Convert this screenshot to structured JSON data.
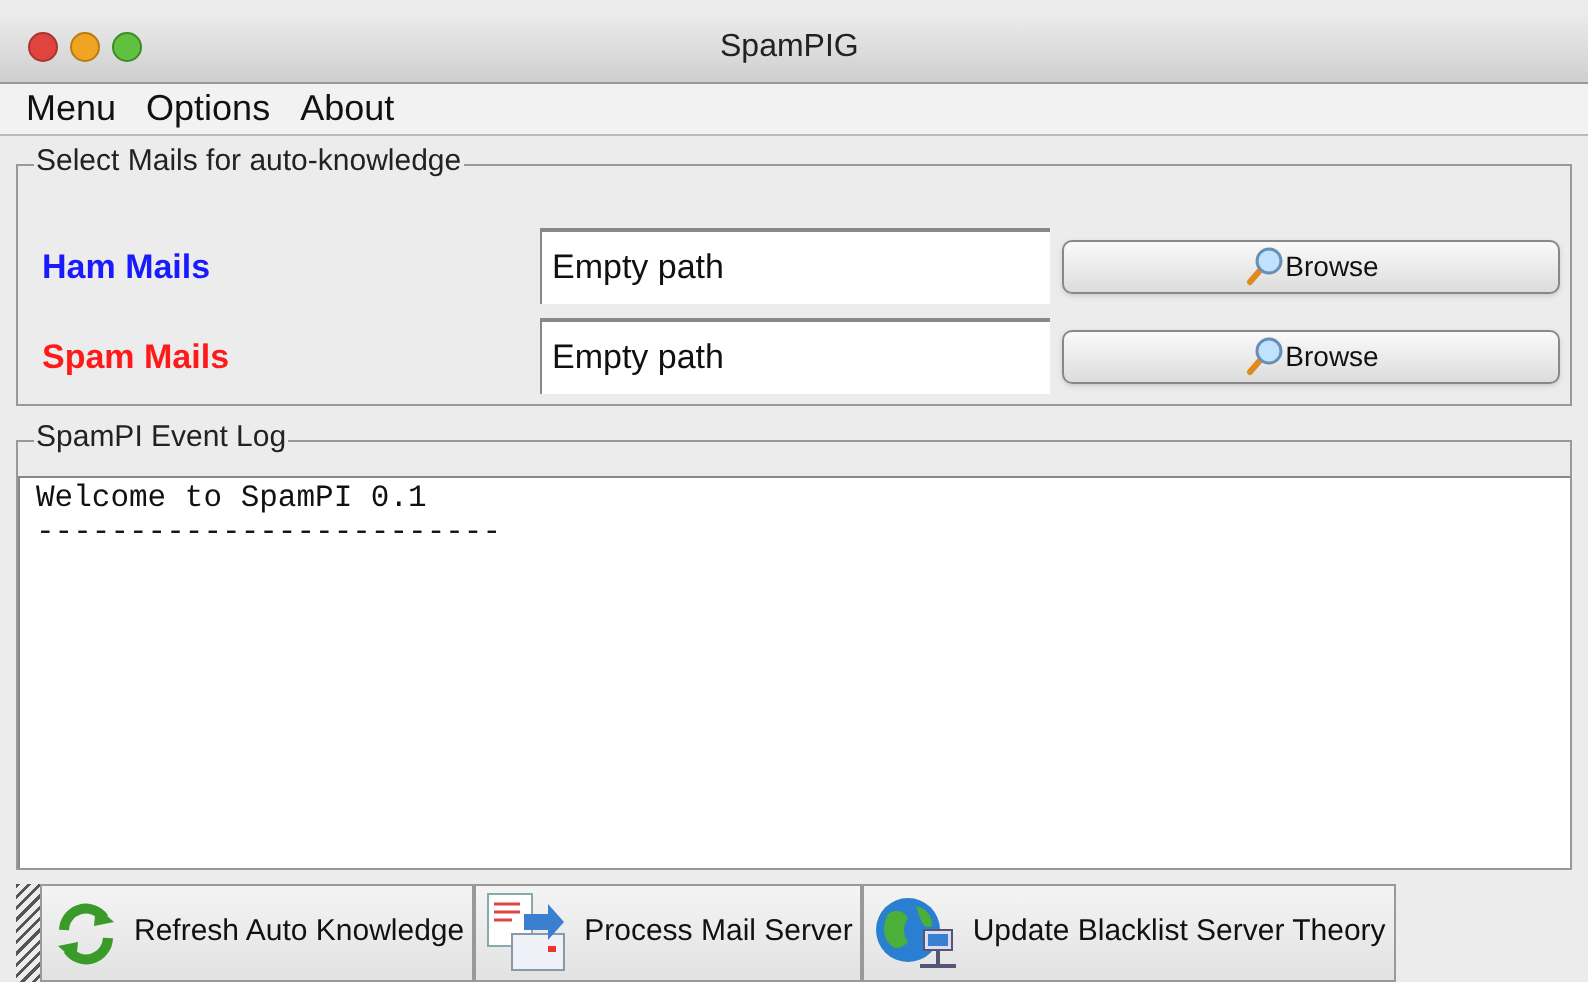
{
  "window": {
    "title": "SpamPIG"
  },
  "menu": [
    "Menu",
    "Options",
    "About"
  ],
  "mail_group": {
    "title": "Select Mails for auto-knowledge",
    "rows": [
      {
        "label": "Ham Mails",
        "color": "#1a1aff",
        "path": "Empty path",
        "button": "Browse"
      },
      {
        "label": "Spam Mails",
        "color": "#ff1a1a",
        "path": "Empty path",
        "button": "Browse"
      }
    ]
  },
  "log_group": {
    "title": "SpamPI Event Log",
    "lines": [
      "Welcome to SpamPI 0.1",
      "-------------------------"
    ]
  },
  "toolbar": [
    {
      "kind": "refresh",
      "label": "Refresh Auto Knowledge"
    },
    {
      "kind": "process",
      "label": "Process Mail Server"
    },
    {
      "kind": "globe",
      "label": "Update Blacklist Server Theory"
    }
  ]
}
